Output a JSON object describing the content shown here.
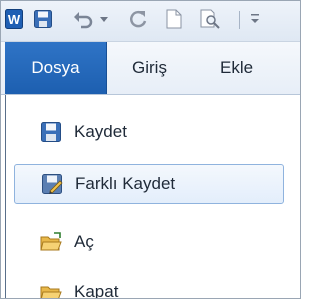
{
  "quick_access": {
    "icons": [
      "word-logo-icon",
      "save-icon",
      "undo-icon",
      "dropdown-arrow-icon",
      "redo-icon",
      "new-document-icon",
      "print-preview-icon",
      "customize-quick-access-icon"
    ]
  },
  "tabs": {
    "file_label": "Dosya",
    "home_label": "Giriş",
    "insert_label": "Ekle"
  },
  "backstage_menu": {
    "items": [
      {
        "label": "Kaydet",
        "icon": "save-icon"
      },
      {
        "label": "Farklı Kaydet",
        "icon": "save-as-icon"
      },
      {
        "label": "Aç",
        "icon": "open-folder-icon"
      },
      {
        "label": "Kapat",
        "icon": "close-folder-icon"
      }
    ]
  },
  "colors": {
    "file_tab": "#2a6cbf",
    "selected_item_bg": "#e6f0fb",
    "selected_item_border": "#8fb3de"
  }
}
